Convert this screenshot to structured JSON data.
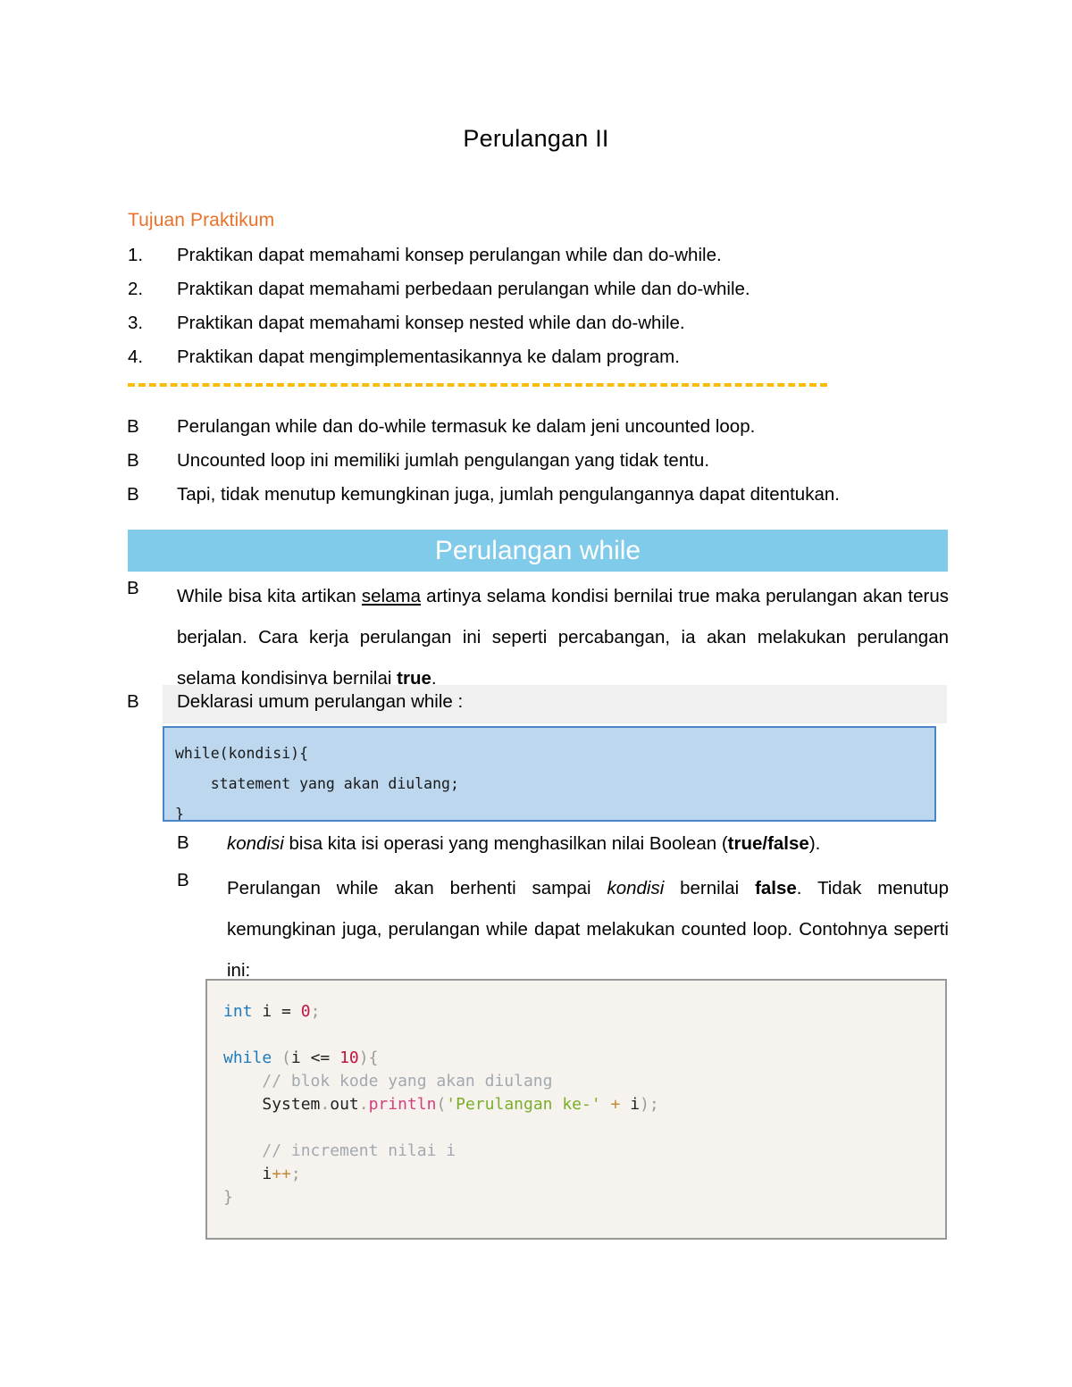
{
  "document": {
    "title": "Perulangan II"
  },
  "section": {
    "heading": "Tujuan  Praktikum"
  },
  "objectives": [
    {
      "marker": "1.",
      "text": "Praktikan dapat memahami konsep perulangan while dan do-while."
    },
    {
      "marker": "2.",
      "text": "Praktikan dapat memahami perbedaan perulangan while dan do-while."
    },
    {
      "marker": "3.",
      "text": "Praktikan dapat memahami konsep nested while dan do-while."
    },
    {
      "marker": "4.",
      "text": "Praktikan dapat mengimplementasikannya ke dalam program."
    }
  ],
  "bullets_intro": [
    {
      "marker": "B",
      "text": "Perulangan while dan do-while termasuk ke dalam jeni uncounted loop."
    },
    {
      "marker": "B",
      "text": "Uncounted loop ini memiliki jumlah pengulangan yang tidak tentu."
    },
    {
      "marker": "B",
      "text": "Tapi, tidak menutup kemungkinan juga, jumlah pengulangannya dapat ditentukan."
    }
  ],
  "banner": {
    "label": "Perulangan while",
    "background_color": "#81cbea",
    "text_color": "#ffffff"
  },
  "while_paragraph": {
    "marker": "B",
    "part1": "While bisa kita artikan ",
    "underlined": "selama",
    "part2": " artinya selama kondisi bernilai true maka perulangan akan terus berjalan. Cara kerja perulangan ini seperti percabangan, ia akan melakukan perulangan selama kondisinya bernilai ",
    "bold": "true",
    "part3": "."
  },
  "deklarasi": {
    "marker": "B",
    "text": "Deklarasi umum perulangan while :"
  },
  "code_declaration": {
    "lines": [
      "while(kondisi){",
      "    statement yang akan diulang;",
      "}"
    ],
    "background_color": "#bdd7ee",
    "border_color": "#4a86c7"
  },
  "bullets_detail": [
    {
      "marker": "B",
      "italic1": "kondisi",
      "text1": " bisa kita isi operasi yang menghasilkan nilai Boolean (",
      "bold1": "true/false",
      "text2": ")."
    },
    {
      "marker": "B",
      "text1": "Perulangan while akan berhenti sampai ",
      "italic1": "kondisi",
      "text2": " bernilai ",
      "bold1": "false",
      "text3": ". Tidak menutup kemungkinan juga, perulangan while dapat melakukan counted loop. Contohnya seperti ini:"
    }
  ],
  "code_example": {
    "background_color": "#f6f3ef",
    "border_color": "#989898",
    "tokens": [
      [
        {
          "t": "int",
          "c": "kw"
        },
        {
          "t": " i ",
          "c": "pln"
        },
        {
          "t": "=",
          "c": "pln"
        },
        {
          "t": " ",
          "c": "pln"
        },
        {
          "t": "0",
          "c": "num"
        },
        {
          "t": ";",
          "c": "pun"
        }
      ],
      [],
      [
        {
          "t": "while",
          "c": "kw"
        },
        {
          "t": " (",
          "c": "pun"
        },
        {
          "t": "i",
          "c": "pln"
        },
        {
          "t": " ",
          "c": "pln"
        },
        {
          "t": "<=",
          "c": "pln"
        },
        {
          "t": " ",
          "c": "pln"
        },
        {
          "t": "10",
          "c": "num"
        },
        {
          "t": ")",
          "c": "pun"
        },
        {
          "t": "{",
          "c": "pun"
        }
      ],
      [
        {
          "t": "    ",
          "c": "pln"
        },
        {
          "t": "// blok kode yang akan diulang",
          "c": "cmt"
        }
      ],
      [
        {
          "t": "    ",
          "c": "pln"
        },
        {
          "t": "System",
          "c": "pln"
        },
        {
          "t": ".",
          "c": "pun"
        },
        {
          "t": "out",
          "c": "pln"
        },
        {
          "t": ".",
          "c": "pun"
        },
        {
          "t": "println",
          "c": "fn"
        },
        {
          "t": "(",
          "c": "pun"
        },
        {
          "t": "'Perulangan ke-'",
          "c": "str"
        },
        {
          "t": " ",
          "c": "pln"
        },
        {
          "t": "+",
          "c": "op"
        },
        {
          "t": " i",
          "c": "pln"
        },
        {
          "t": ");",
          "c": "pun"
        }
      ],
      [],
      [
        {
          "t": "    ",
          "c": "pln"
        },
        {
          "t": "// increment nilai i",
          "c": "cmt"
        }
      ],
      [
        {
          "t": "    ",
          "c": "pln"
        },
        {
          "t": "i",
          "c": "pln"
        },
        {
          "t": "++",
          "c": "op"
        },
        {
          "t": ";",
          "c": "pun"
        }
      ],
      [
        {
          "t": "}",
          "c": "pun"
        }
      ]
    ]
  },
  "colors": {
    "accent_orange": "#e8722a",
    "divider_gold": "#fbbc09",
    "banner_blue": "#81cbea",
    "code_blue_fill": "#bdd7ee",
    "code_blue_border": "#4a86c7",
    "code_java_fill": "#f6f3ef",
    "code_java_border": "#989898",
    "gray_strip": "#f0f0f0"
  }
}
